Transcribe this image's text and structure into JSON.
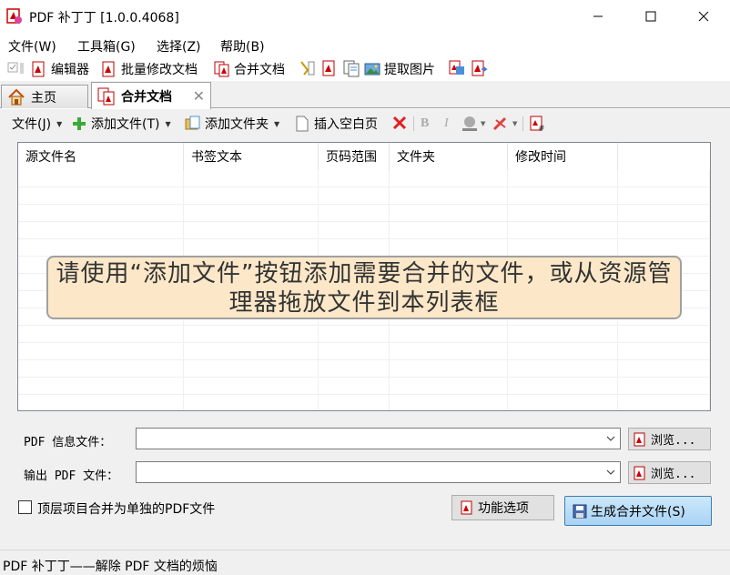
{
  "window": {
    "title": "PDF 补丁丁 [1.0.0.4068]"
  },
  "menu": [
    "文件(W)",
    "工具箱(G)",
    "选择(Z)",
    "帮助(B)"
  ],
  "toolbar": {
    "editor": "编辑器",
    "batch_modify": "批量修改文档",
    "merge": "合并文档",
    "extract_images": "提取图片"
  },
  "tabs": {
    "home": "主页",
    "merge": "合并文档"
  },
  "subtoolbar": {
    "file": "文件(J)",
    "add_file": "添加文件(T)",
    "add_folder": "添加文件夹",
    "insert_blank": "插入空白页"
  },
  "list": {
    "columns": [
      "源文件名",
      "书签文本",
      "页码范围",
      "文件夹",
      "修改时间",
      ""
    ],
    "hint": "请使用“添加文件”按钮添加需要合并的文件，或从资源管理器拖放文件到本列表框"
  },
  "form": {
    "info_label": "PDF 信息文件：",
    "info_value": "",
    "output_label": "输出 PDF 文件：",
    "output_value": "",
    "browse": "浏览...",
    "checkbox_label": "顶层项目合并为单独的PDF文件",
    "options_button": "功能选项",
    "generate_button": "生成合并文件(S)"
  },
  "status": {
    "text": "PDF 补丁丁——解除 PDF 文档的烦恼"
  },
  "colors": {
    "accent": "#a9d3f5",
    "hint_bg": "#fce8c8"
  }
}
